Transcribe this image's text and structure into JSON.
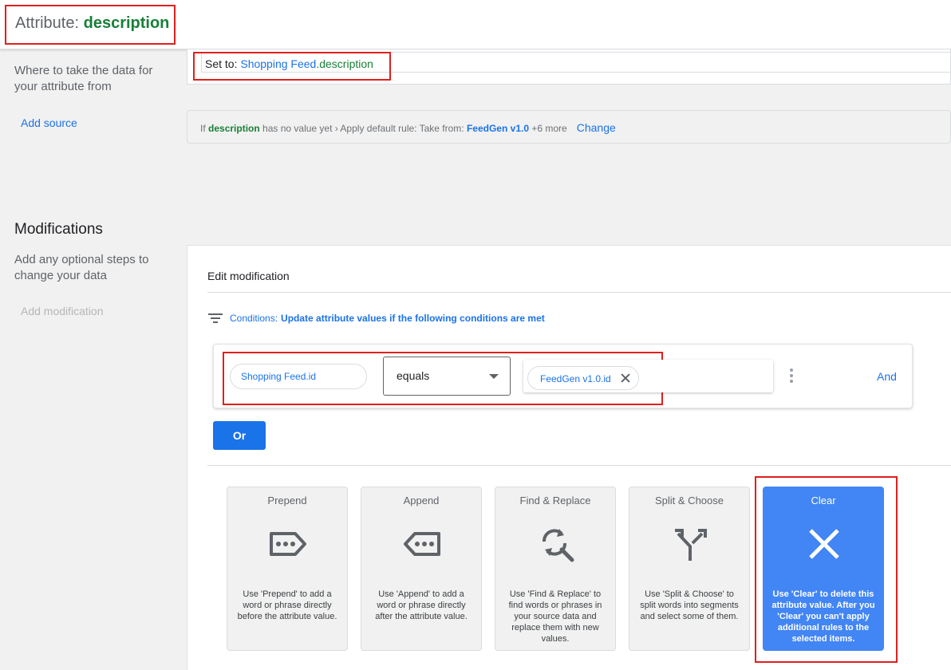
{
  "header": {
    "attribute_prefix": "Attribute: ",
    "attribute_name": "description"
  },
  "source_section": {
    "description": "Where to take the data for your attribute from",
    "add_source_label": "Add source",
    "set_to_prefix": "Set to: ",
    "set_to_source": "Shopping Feed",
    "set_to_attribute": ".description",
    "default_rule": {
      "prefix": "If ",
      "attribute": "description",
      "middle": " has no value yet › Apply default rule: Take from: ",
      "source": "FeedGen v1.0",
      "more": " +6 more",
      "change_label": "Change"
    }
  },
  "modifications": {
    "heading": "Modifications",
    "description": "Add any optional steps to change your data",
    "add_modification_label": "Add modification",
    "edit_title": "Edit modification",
    "conditions_label": "Conditions:",
    "conditions_text": "Update attribute values if the following conditions are met",
    "condition": {
      "attribute": "Shopping Feed.id",
      "operator": "equals",
      "value": "FeedGen v1.0.id"
    },
    "and_label": "And",
    "or_label": "Or",
    "tiles": [
      {
        "name": "Prepend",
        "icon": "prepend-icon",
        "description": "Use 'Prepend' to add a word or phrase directly before the attribute value."
      },
      {
        "name": "Append",
        "icon": "append-icon",
        "description": "Use 'Append' to add a word or phrase directly after the attribute value."
      },
      {
        "name": "Find & Replace",
        "icon": "find-replace-icon",
        "description": "Use 'Find & Replace' to find words or phrases in your source data and replace them with new values."
      },
      {
        "name": "Split & Choose",
        "icon": "split-choose-icon",
        "description": "Use 'Split & Choose' to split words into segments and select some of them."
      },
      {
        "name": "Clear",
        "icon": "clear-icon",
        "description": "Use 'Clear' to delete this attribute value. After you 'Clear' you can't apply additional rules to the selected items."
      }
    ]
  },
  "colors": {
    "accent_blue": "#1a73e8",
    "attribute_green": "#188038",
    "highlight_red": "#e0201b",
    "active_tile": "#4285f4"
  }
}
